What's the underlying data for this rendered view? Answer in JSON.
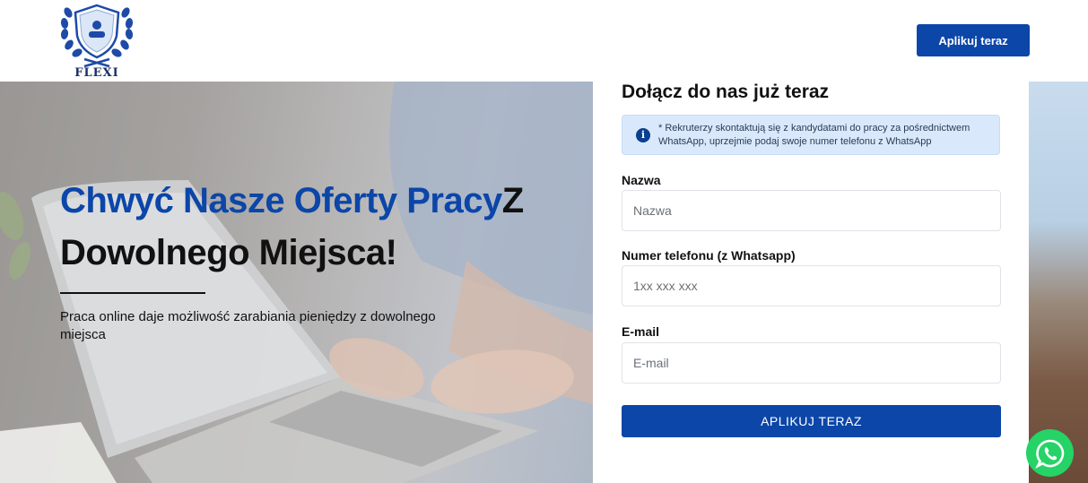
{
  "header": {
    "logo_text": "FLEXI",
    "cta_label": "Aplikuj teraz"
  },
  "hero": {
    "title_blue": "Chwyć Nasze Oferty Pracy",
    "title_dark_1": "Z",
    "title_dark_2": "Dowolnego Miejsca!",
    "subtitle": "Praca online daje możliwość zarabiania pieniędzy z dowolnego miejsca"
  },
  "form": {
    "title": "Dołącz do nas już teraz",
    "info_text": "* Rekruterzy skontaktują się z kandydatami do pracy za pośrednictwem WhatsApp, uprzejmie podaj swoje numer telefonu z WhatsApp",
    "fields": [
      {
        "label": "Nazwa",
        "placeholder": "Nazwa",
        "value": ""
      },
      {
        "label": "Numer telefonu (z Whatsapp)",
        "placeholder": "1xx xxx xxx",
        "value": ""
      },
      {
        "label": "E-mail",
        "placeholder": "E-mail",
        "value": ""
      }
    ],
    "submit_label": "APLIKUJ TERAZ"
  },
  "icons": {
    "logo": "shield-laurel-logo-icon",
    "info": "info-icon",
    "whatsapp": "whatsapp-icon"
  },
  "colors": {
    "brand_blue": "#0b46a8",
    "info_bg": "#d9e9fb",
    "whatsapp_green": "#25d366"
  }
}
